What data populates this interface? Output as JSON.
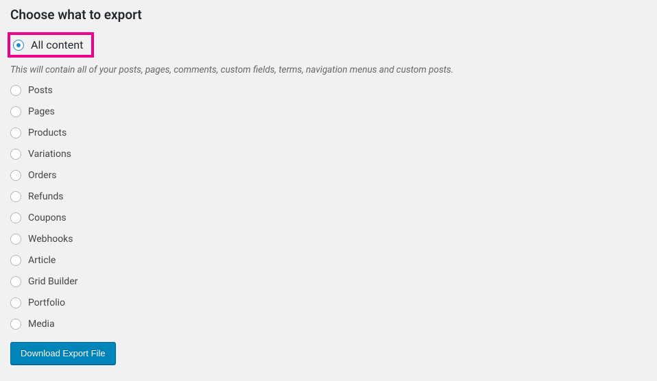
{
  "heading": "Choose what to export",
  "options": {
    "all_content": "All content",
    "posts": "Posts",
    "pages": "Pages",
    "products": "Products",
    "variations": "Variations",
    "orders": "Orders",
    "refunds": "Refunds",
    "coupons": "Coupons",
    "webhooks": "Webhooks",
    "article": "Article",
    "grid_builder": "Grid Builder",
    "portfolio": "Portfolio",
    "media": "Media"
  },
  "description": "This will contain all of your posts, pages, comments, custom fields, terms, navigation menus and custom posts.",
  "button_label": "Download Export File",
  "selected": "all_content"
}
